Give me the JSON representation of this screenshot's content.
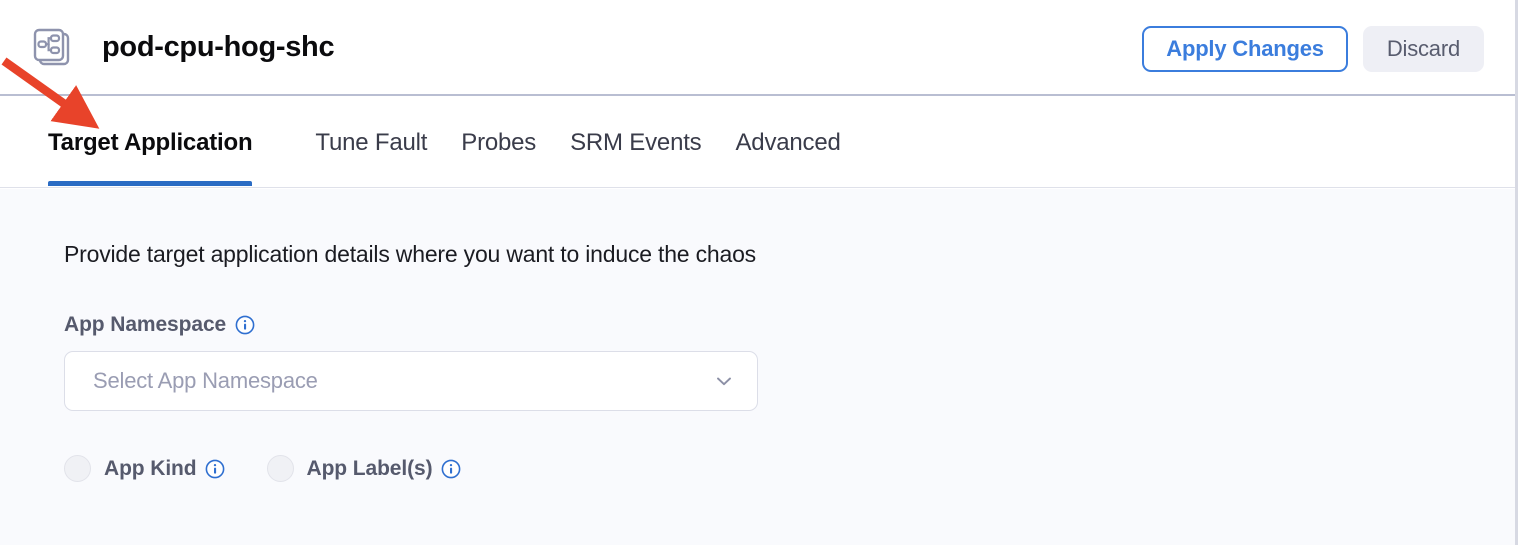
{
  "header": {
    "icon_name": "stacked-workflow-icon",
    "title": "pod-cpu-hog-shc",
    "apply_label": "Apply Changes",
    "discard_label": "Discard"
  },
  "tabs": [
    {
      "label": "Target Application",
      "active": true
    },
    {
      "label": "Tune Fault",
      "active": false
    },
    {
      "label": "Probes",
      "active": false
    },
    {
      "label": "SRM Events",
      "active": false
    },
    {
      "label": "Advanced",
      "active": false
    }
  ],
  "main": {
    "description": "Provide target application details where you want to induce the chaos",
    "namespace_field": {
      "label": "App Namespace",
      "info_icon": "info-icon",
      "placeholder": "Select App Namespace",
      "value": "",
      "chevron_icon": "chevron-down-icon"
    },
    "radio_options": [
      {
        "label": "App Kind",
        "info_icon": "info-icon",
        "selected": false
      },
      {
        "label": "App Label(s)",
        "info_icon": "info-icon",
        "selected": false
      }
    ]
  },
  "annotation": {
    "type": "arrow",
    "color": "#e8432a",
    "points_to": "Target Application"
  },
  "colors": {
    "accent_blue": "#3b7ddd",
    "tab_underline": "#2b6cc4",
    "content_bg": "#f9fafd",
    "header_bg": "#ffffff",
    "label_gray": "#565a6d",
    "placeholder_gray": "#9a9db3",
    "annotation_red": "#e8432a"
  }
}
